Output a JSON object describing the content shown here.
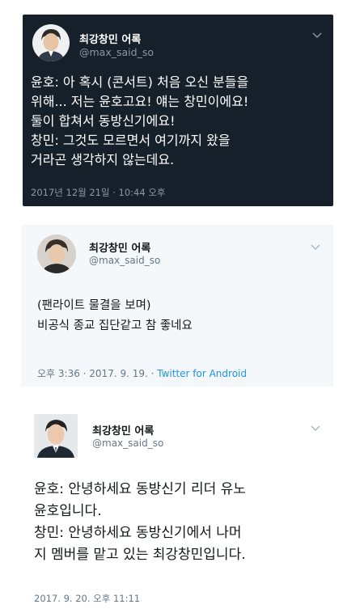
{
  "tweets": [
    {
      "display_name": "최강창민 어록",
      "handle": "@max_said_so",
      "text": "윤호: 아 혹시 (콘서트) 처음 오신 분들을\n위해... 저는 윤호고요! 얘는 창민이에요!\n둘이 합쳐서 동방신기에요!\n창민: 그것도 모르면서 여기까지 왔을\n거라곤 생각하지 않는데요.",
      "timestamp": "2017년 12월 21일 · 10:44 오후"
    },
    {
      "display_name": "최강창민 어록",
      "handle": "@max_said_so",
      "text": "(팬라이트 물결을 보며)\n비공식 종교 집단같고 참 좋네요",
      "timestamp": "오후 3:36 · 2017. 9. 19. · ",
      "via": "Twitter for Android"
    },
    {
      "display_name": "최강창민 어록",
      "handle": "@max_said_so",
      "text": "윤호: 안녕하세요 동방신기 리더 유노\n윤호입니다.\n창민: 안녕하세요 동방신기에서 나머\n지 멤버를 맡고 있는 최강창민입니다.",
      "timestamp": "2017. 9. 20. 오후 11:11"
    }
  ],
  "colors": {
    "dark_bg": "#15202b",
    "light_bg": "#f5f8fa",
    "link": "#1b95e0"
  },
  "icons": [
    "avatar",
    "chevron-down-icon"
  ]
}
